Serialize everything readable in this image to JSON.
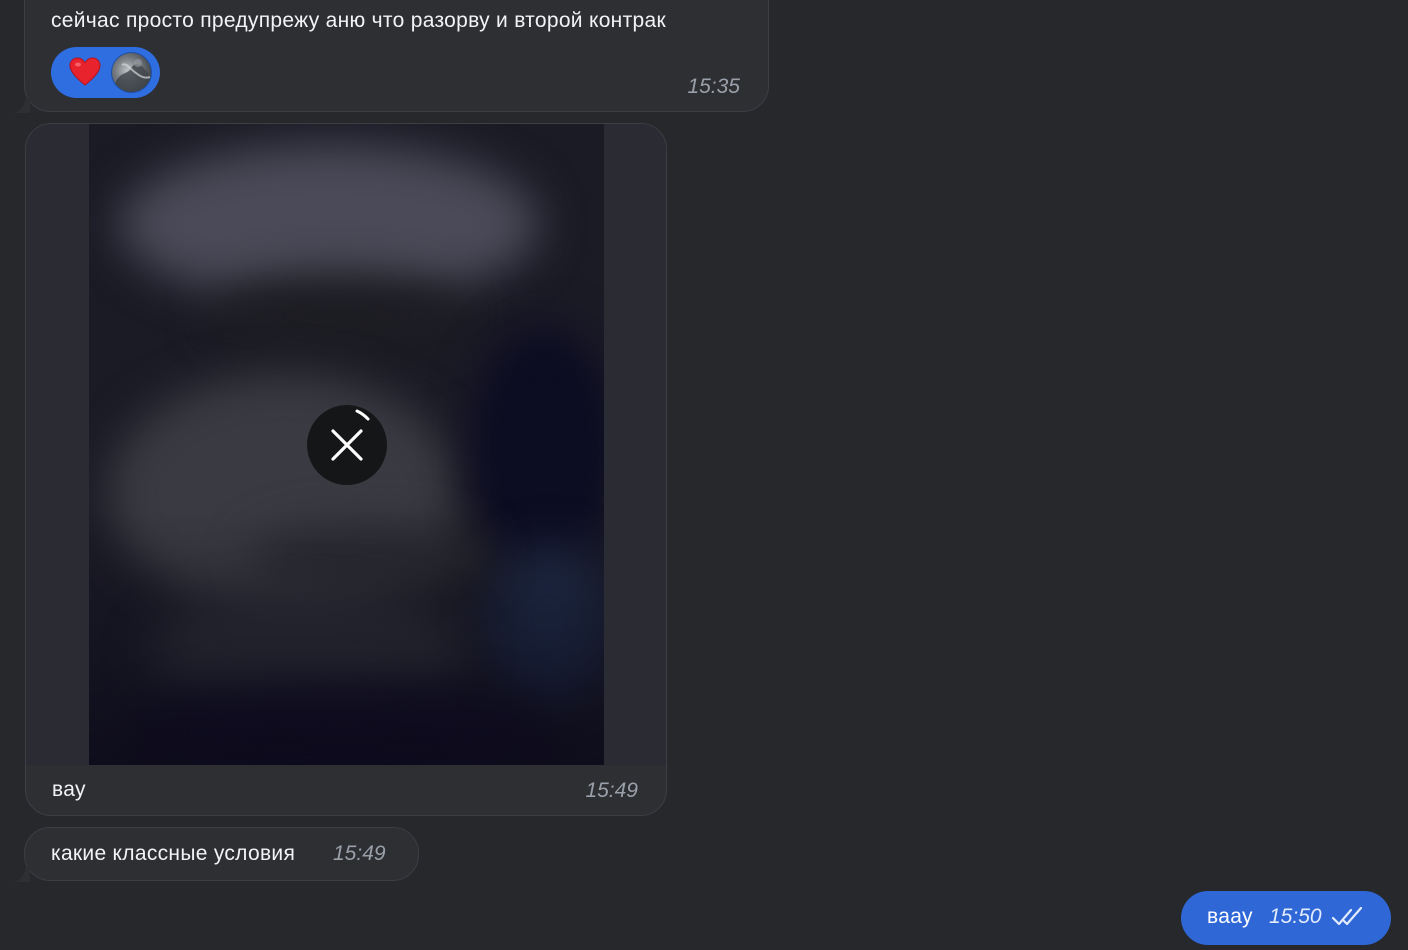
{
  "messages": [
    {
      "text": "сейчас просто предупрежу аню что разорву и второй контрак",
      "time": "15:35",
      "reaction": {
        "emoji_icon": "heart-icon",
        "has_avatar": true,
        "color": "#2f6ee0"
      }
    },
    {
      "media": "blurred-photo",
      "loading": true,
      "caption": "вау",
      "time": "15:49"
    },
    {
      "text": "какие классные условия",
      "time": "15:49"
    }
  ],
  "outgoing": {
    "text": "ваау",
    "time": "15:50",
    "status_icon": "double-check-icon"
  },
  "colors": {
    "background": "#26282b",
    "incoming_bubble": "#2d2f33",
    "outgoing_bubble": "#2f68d6",
    "time_text": "#9aa0aa"
  }
}
